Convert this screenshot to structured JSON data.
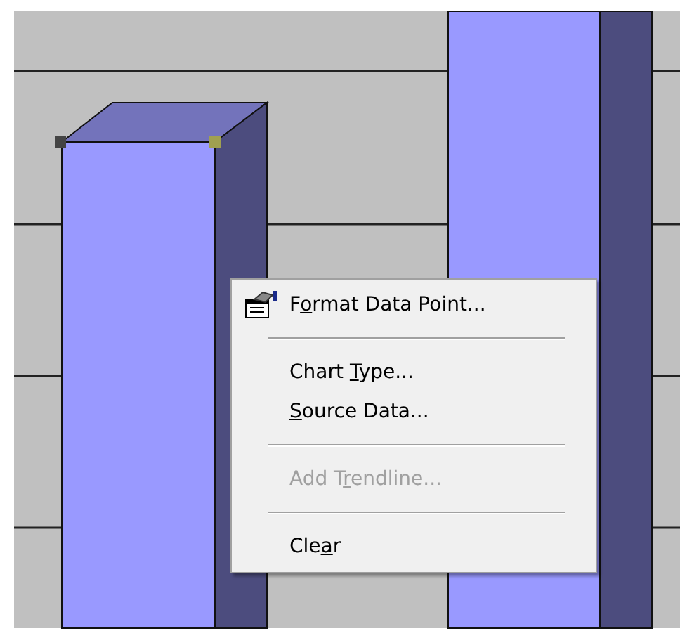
{
  "context_menu": {
    "items": [
      {
        "kind": "command",
        "label_start": "F",
        "access_key": "o",
        "label_end": "rmat Data Point...",
        "has_icon": true,
        "disabled": false
      },
      {
        "kind": "separator"
      },
      {
        "kind": "command",
        "label_start": "Chart ",
        "access_key": "T",
        "label_end": "ype...",
        "has_icon": false,
        "disabled": false
      },
      {
        "kind": "command",
        "access_key": "S",
        "label_end": "ource Data...",
        "has_icon": false,
        "disabled": false
      },
      {
        "kind": "separator"
      },
      {
        "kind": "command",
        "label_start": "Add T",
        "access_key": "r",
        "label_end": "endline...",
        "has_icon": false,
        "disabled": true
      },
      {
        "kind": "separator"
      },
      {
        "kind": "command",
        "label_start": "Cle",
        "access_key": "a",
        "label_end": "r",
        "has_icon": false,
        "disabled": false
      }
    ]
  }
}
